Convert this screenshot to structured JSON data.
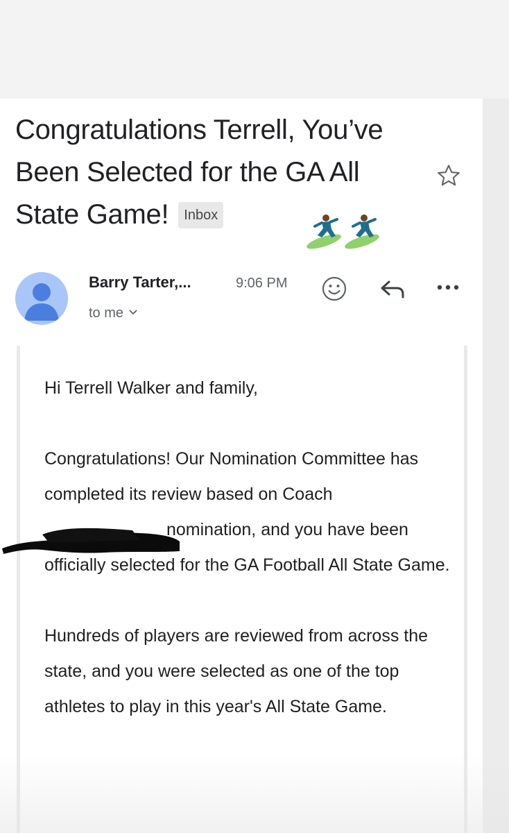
{
  "email": {
    "subject": "Congratulations Terrell, You’ve Been Selected for the GA All State Game!",
    "label": "Inbox",
    "decoration": "surfer-emoji-pair",
    "sender": "Barry Tarter,...",
    "time": "9:06 PM",
    "recipient": "to me",
    "icons": {
      "star": "star-outline-icon",
      "emoji": "smiley-icon",
      "reply": "reply-icon",
      "more": "more-horizontal-icon",
      "recipient_expand": "chevron-down-icon",
      "avatar": "person-icon"
    },
    "body": {
      "greeting": "Hi Terrell Walker and family,",
      "paragraph1": "Congratulations! Our Nomination Committee has completed its review based on Coach",
      "paragraph1_after_redaction": "nomination, and you have been officially selected for the GA Football All State Game.",
      "paragraph2": "Hundreds of players are reviewed from across the state, and you were selected as one of the top athletes to play in this year's All State Game."
    }
  },
  "colors": {
    "avatar_bg": "#a9c6f8",
    "avatar_fg": "#4a7fe0",
    "chip_bg": "#e8e8e8",
    "text": "#202124",
    "muted": "#5f6368"
  }
}
